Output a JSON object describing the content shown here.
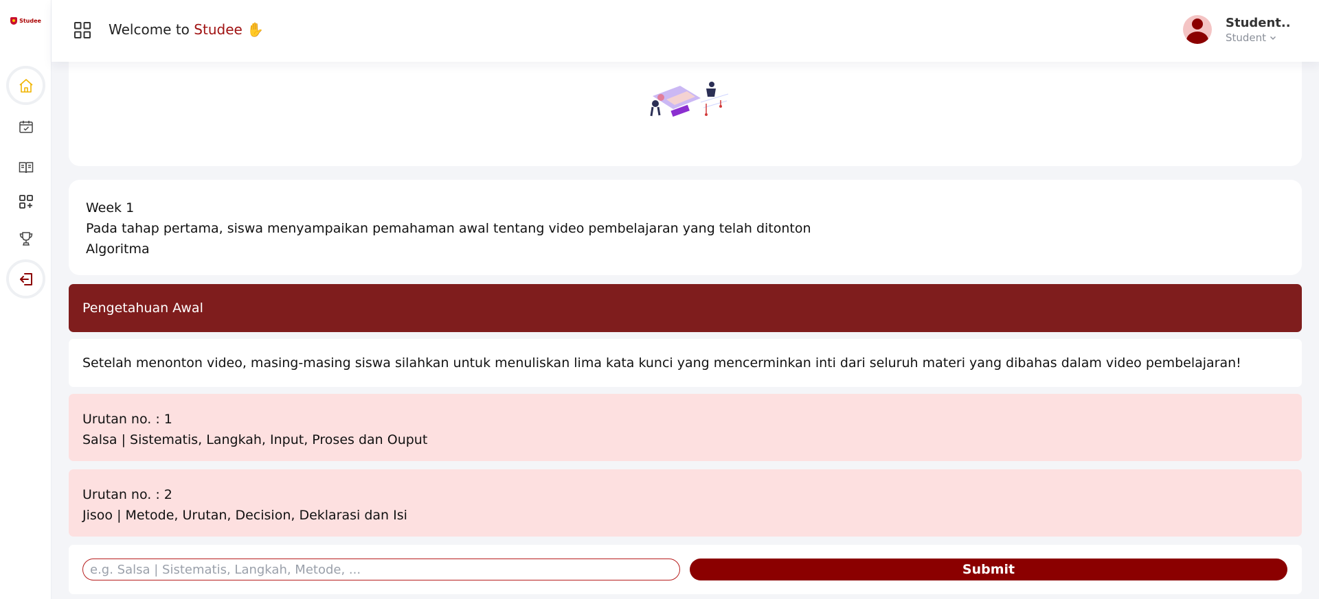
{
  "app": {
    "logo_text": "Studee"
  },
  "sidebar": {
    "items": [
      {
        "name": "home",
        "icon": "home-icon",
        "active": true
      },
      {
        "name": "schedule",
        "icon": "calendar-check-icon"
      },
      {
        "name": "materials",
        "icon": "book-open-icon"
      },
      {
        "name": "add-apps",
        "icon": "apps-add-icon"
      },
      {
        "name": "achievements",
        "icon": "trophy-icon"
      },
      {
        "name": "logout",
        "icon": "logout-icon"
      }
    ]
  },
  "header": {
    "welcome_prefix": "Welcome to ",
    "brand": "Studee",
    "wave_emoji": "✋",
    "user_name": "Student..",
    "user_role": "Student"
  },
  "info": {
    "week": "Week 1",
    "description": "Pada tahap pertama, siswa menyampaikan pemahaman awal tentang video pembelajaran yang telah ditonton",
    "topic": "Algoritma"
  },
  "section": {
    "title": "Pengetahuan Awal",
    "instruction": "Setelah menonton video, masing-masing siswa silahkan untuk menuliskan lima kata kunci yang mencerminkan inti dari seluruh materi yang dibahas dalam video pembelajaran!"
  },
  "answers": [
    {
      "order": "Urutan no. : 1",
      "text": "Salsa | Sistematis, Langkah, Input, Proses dan Ouput"
    },
    {
      "order": "Urutan no. : 2",
      "text": "Jisoo | Metode, Urutan, Decision, Deklarasi dan Isi"
    }
  ],
  "form": {
    "placeholder": "e.g. Salsa | Sistematis, Langkah, Metode, ...",
    "value": "",
    "submit_label": "Submit"
  },
  "colors": {
    "brand": "#a01212",
    "section_header": "#7f1d1d",
    "answer_bg": "#fde0e0",
    "submit_bg": "#8b0000",
    "active_icon": "#f0b400"
  }
}
